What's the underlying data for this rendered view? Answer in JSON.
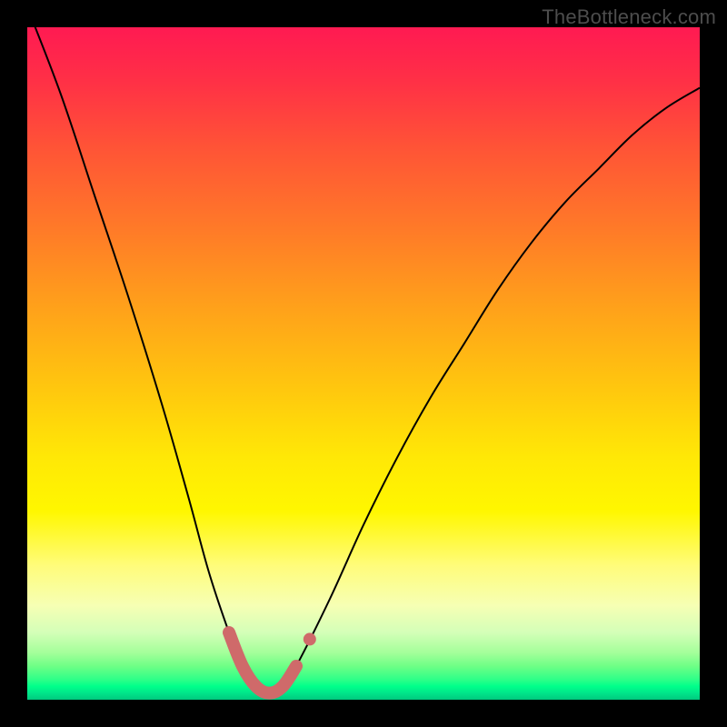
{
  "watermark": "TheBottleneck.com",
  "colors": {
    "curve": "#000000",
    "marker": "#cf6a6a",
    "frame": "#000000"
  },
  "chart_data": {
    "type": "line",
    "title": "",
    "xlabel": "",
    "ylabel": "",
    "xlim": [
      0,
      100
    ],
    "ylim": [
      0,
      100
    ],
    "grid": false,
    "legend": false,
    "annotations": [
      "TheBottleneck.com"
    ],
    "series": [
      {
        "name": "bottleneck-curve",
        "x": [
          0,
          5,
          10,
          15,
          20,
          24,
          27,
          30,
          32,
          34,
          36,
          38,
          40,
          45,
          50,
          55,
          60,
          65,
          70,
          75,
          80,
          85,
          90,
          95,
          100
        ],
        "values": [
          103,
          90,
          75,
          60,
          44,
          30,
          19,
          10,
          5,
          2,
          1,
          2,
          5,
          15,
          26,
          36,
          45,
          53,
          61,
          68,
          74,
          79,
          84,
          88,
          91
        ]
      }
    ],
    "highlight": {
      "name": "optimal-range",
      "x": [
        30,
        32,
        34,
        36,
        38,
        40
      ],
      "values": [
        10,
        5,
        2,
        1,
        2,
        5
      ],
      "extra_point": {
        "x": 42,
        "value": 9
      }
    },
    "background_gradient": {
      "orientation": "vertical",
      "stops": [
        {
          "pos": 0.0,
          "color": "#ff1a52"
        },
        {
          "pos": 0.5,
          "color": "#ffd400"
        },
        {
          "pos": 0.85,
          "color": "#fff700"
        },
        {
          "pos": 1.0,
          "color": "#00c97e"
        }
      ]
    }
  }
}
